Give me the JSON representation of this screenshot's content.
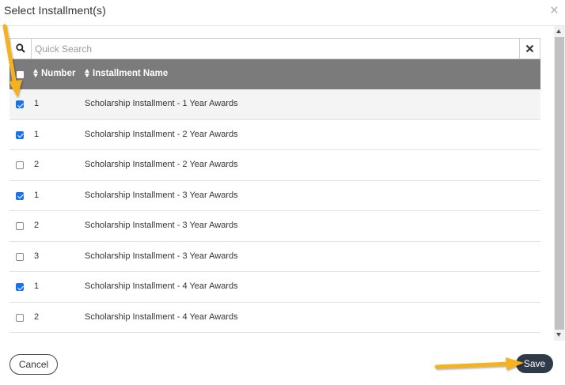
{
  "modal": {
    "title": "Select Installment(s)",
    "close_glyph": "×"
  },
  "search": {
    "placeholder": "Quick Search",
    "value": "",
    "clear_glyph": "✕"
  },
  "table": {
    "columns": {
      "number": "Number",
      "name": "Installment Name"
    },
    "rows": [
      {
        "checked": true,
        "number": "1",
        "name": "Scholarship Installment - 1 Year Awards"
      },
      {
        "checked": true,
        "number": "1",
        "name": "Scholarship Installment - 2 Year Awards"
      },
      {
        "checked": false,
        "number": "2",
        "name": "Scholarship Installment - 2 Year Awards"
      },
      {
        "checked": true,
        "number": "1",
        "name": "Scholarship Installment - 3 Year Awards"
      },
      {
        "checked": false,
        "number": "2",
        "name": "Scholarship Installment - 3 Year Awards"
      },
      {
        "checked": false,
        "number": "3",
        "name": "Scholarship Installment - 3 Year Awards"
      },
      {
        "checked": true,
        "number": "1",
        "name": "Scholarship Installment - 4 Year Awards"
      },
      {
        "checked": false,
        "number": "2",
        "name": "Scholarship Installment - 4 Year Awards"
      }
    ]
  },
  "footer": {
    "cancel_label": "Cancel",
    "save_label": "Save"
  },
  "colors": {
    "header_bg": "#7b7b7b",
    "checkbox_checked": "#1a73e8",
    "save_bg": "#2e3a48",
    "annotation_arrow": "#f5b21b"
  }
}
